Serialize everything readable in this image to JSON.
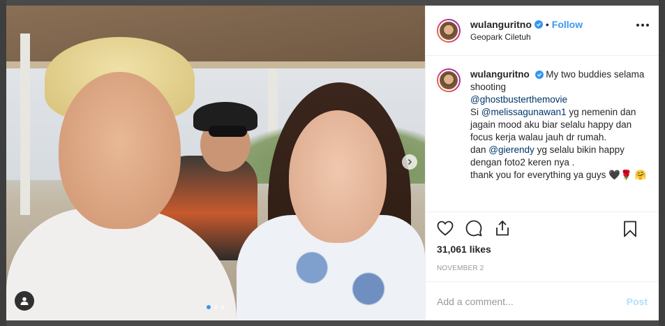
{
  "post": {
    "username": "wulanguritno",
    "follow_label": "Follow",
    "separator": "•",
    "location": "Geopark Ciletuh"
  },
  "caption": {
    "username": "wulanguritno",
    "line1": "My two buddies selama shooting",
    "mention1": "@ghostbusterthemovie",
    "line2_pre": "Si",
    "mention2": "@melissagunawan1",
    "line2_post": "yg nemenin dan jagain mood aku biar selalu happy dan focus kerja walau jauh dr rumah.",
    "line3_pre": "dan",
    "mention3": "@gierendy",
    "line3_post": "yg selalu bikin happy dengan foto2 keren nya .",
    "line4": "thank you for everything ya guys",
    "emoji_heart": "🖤",
    "emoji_rose": "🌹",
    "emoji_hug": "🤗"
  },
  "stats": {
    "likes": "31,061 likes",
    "date": "NOVEMBER 2"
  },
  "comment": {
    "placeholder": "Add a comment...",
    "post_label": "Post"
  },
  "carousel": {
    "count": 3,
    "active_index": 0
  },
  "icons": {
    "verified": "verified-badge-icon",
    "more": "more-options-icon",
    "like": "heart-icon",
    "comment": "comment-icon",
    "share": "share-icon",
    "save": "bookmark-icon",
    "tag": "user-tag-icon",
    "next": "chevron-right-icon"
  },
  "colors": {
    "accent": "#3897f0",
    "mention": "#003569",
    "post_disabled": "#b2dffc"
  }
}
